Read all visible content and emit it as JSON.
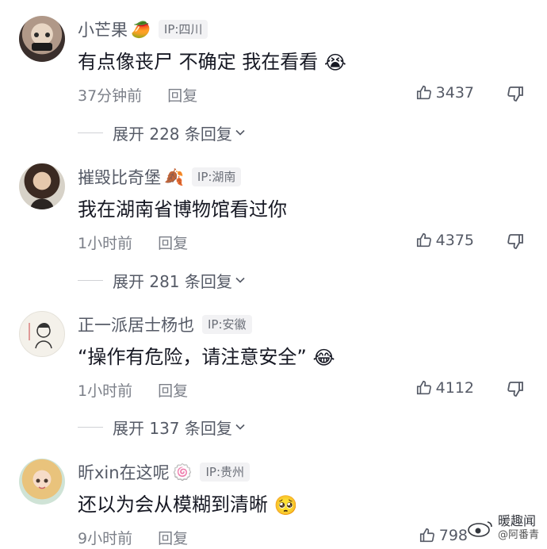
{
  "comments": [
    {
      "username": "小芒果",
      "name_emoji": "🥭",
      "ip": "IP:四川",
      "text": "有点像丧尸 不确定 我在看看",
      "text_emoji": "😭",
      "time": "37分钟前",
      "reply_label": "回复",
      "likes": "3437",
      "replies_label": "展开 228 条回复"
    },
    {
      "username": "摧毁比奇堡",
      "name_emoji": "🍂",
      "ip": "IP:湖南",
      "text": "我在湖南省博物馆看过你",
      "text_emoji": "",
      "time": "1小时前",
      "reply_label": "回复",
      "likes": "4375",
      "replies_label": "展开 281 条回复"
    },
    {
      "username": "正一派居士杨也",
      "name_emoji": "",
      "ip": "IP:安徽",
      "text": "“操作有危险，请注意安全”",
      "text_emoji": "😂",
      "time": "1小时前",
      "reply_label": "回复",
      "likes": "4112",
      "replies_label": "展开 137 条回复"
    },
    {
      "username": "昕xin在这呢",
      "name_emoji": "🍥",
      "ip": "IP:贵州",
      "text": "还以为会从模糊到清晰",
      "text_emoji": "🥺",
      "time": "9小时前",
      "reply_label": "回复",
      "likes": "798",
      "replies_label": ""
    }
  ],
  "watermark": {
    "line1": "暖趣闻",
    "line2": "@阿番青"
  },
  "colors": {
    "username": "#555a66",
    "meta": "#7b7f88",
    "text": "#161823",
    "ip_bg": "#f2f2f4"
  },
  "icons": [
    "like-icon",
    "dislike-icon",
    "chevron-down-icon",
    "weibo-logo-icon"
  ]
}
